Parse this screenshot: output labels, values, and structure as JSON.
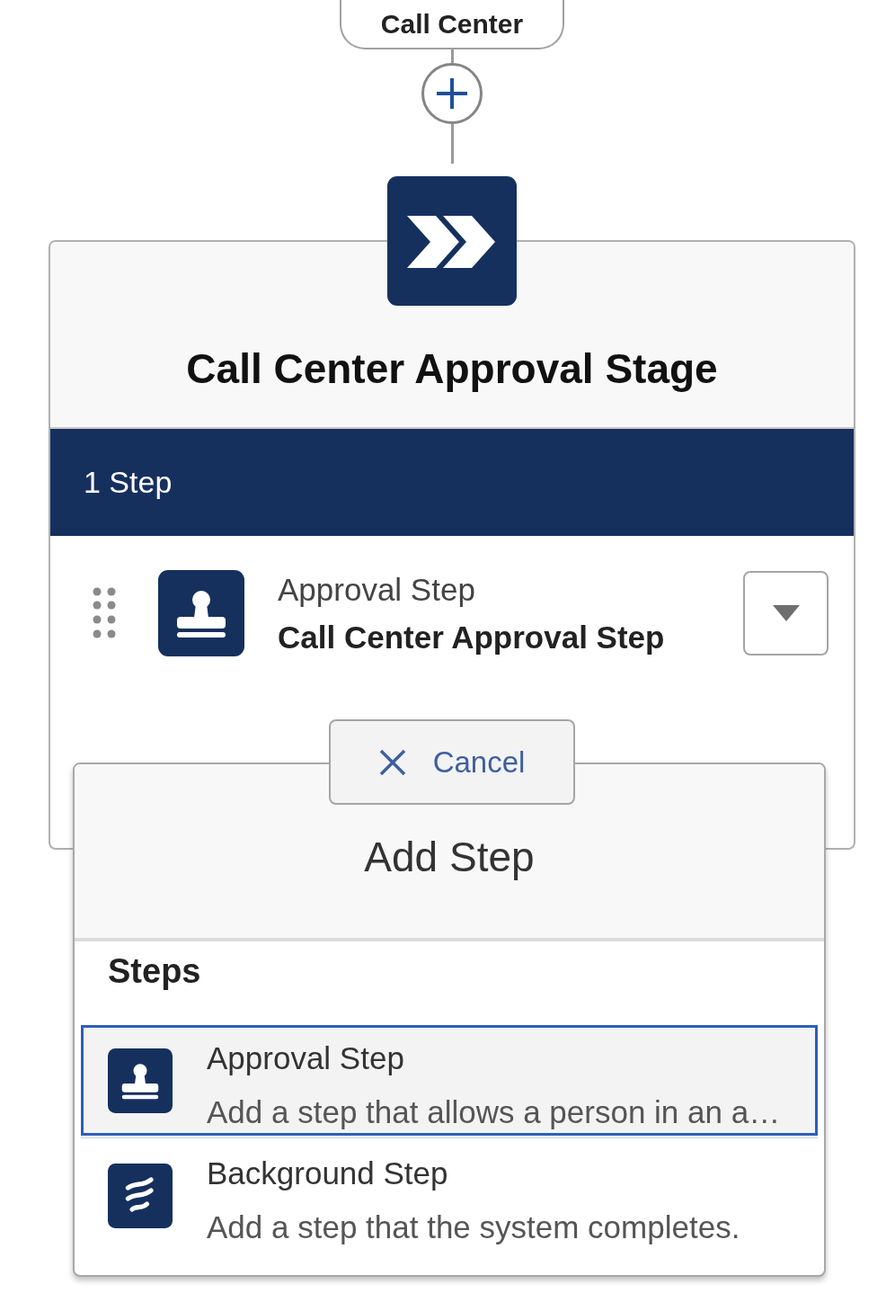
{
  "previous_node": {
    "label": "Call Center"
  },
  "stage": {
    "title": "Call Center Approval Stage",
    "step_count": "1 Step",
    "steps": [
      {
        "kind": "approval",
        "type": "Approval Step",
        "name": "Call Center Approval Step"
      }
    ]
  },
  "add_step_panel": {
    "cancel": "Cancel",
    "title": "Add Step",
    "section": "Steps",
    "options": [
      {
        "kind": "approval",
        "title": "Approval Step",
        "description": "Add a step that allows a person in an a…",
        "selected": true
      },
      {
        "kind": "background",
        "title": "Background Step",
        "description": "Add a step that the system completes.",
        "selected": false
      }
    ]
  }
}
